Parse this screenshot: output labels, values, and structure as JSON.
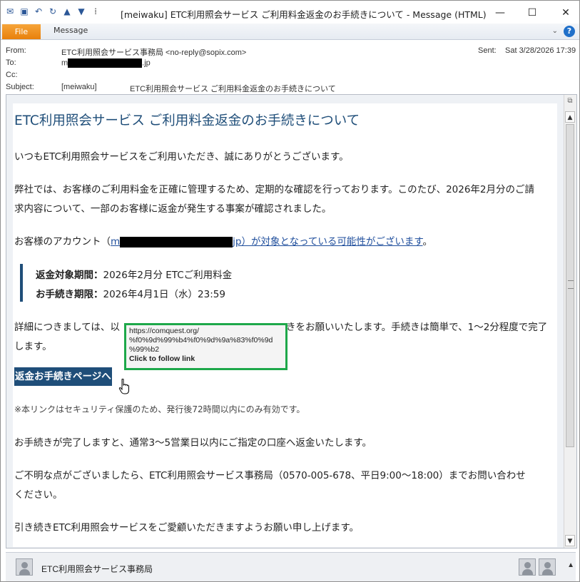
{
  "window": {
    "title": "[meiwaku] ETC利用照会サービス ご利用料金返金のお手続きについて  -  Message (HTML)",
    "tabs": [
      "File",
      "Message"
    ]
  },
  "header": {
    "from_label": "From:",
    "from_value": "ETC利用照会サービス事務局 <no-reply@sopix.com>",
    "to_label": "To:",
    "to_prefix": "m",
    "to_suffix": ".jp",
    "cc_label": "Cc:",
    "subject_label": "Subject:",
    "subject_tag": "[meiwaku]",
    "subject_value": "ETC利用照会サービス ご利用料金返金のお手続きについて",
    "sent_label": "Sent:",
    "sent_value": "Sat 3/28/2026 17:39"
  },
  "email": {
    "heading": "ETC利用照会サービス ご利用料金返金のお手続きについて",
    "p1": "いつもETC利用照会サービスをご利用いただき、誠にありがとうございます。",
    "p2a": "弊社では、お客様のご利用料金を正確に管理するため、定期的な確認を行っております。このたび、2026年2月分のご請",
    "p2b": "求内容について、一部のお客様に返金が発生する事案が確認されました。",
    "p3_prefix": "お客様のアカウント（",
    "p3_link_start": "m",
    "p3_link_end": "jp）が対象となっている可能性がございます",
    "p3_suffix": "。",
    "note_period_label": "返金対象期間：",
    "note_period_value": "2026年2月分 ETCご利用料金",
    "note_deadline_label": "お手続き期限：",
    "note_deadline_value": "2026年4月1日（水）23:59",
    "p4a_left": "詳細につきましては、以",
    "p4a_right": "きをお願いいたします。手続きは簡単で、1～2分程度で完了",
    "p4b": "します。",
    "button_label": "返金お手続きページへ",
    "note_small": "※本リンクはセキュリティ保護のため、発行後72時間以内にのみ有効です。",
    "p5": "お手続きが完了しますと、通常3～5営業日以内にご指定の口座へ返金いたします。",
    "p6a": "ご不明な点がございましたら、ETC利用照会サービス事務局（0570-005-678、平日9:00～18:00）までお問い合わせ",
    "p6b": "ください。",
    "p7": "引き続きETC利用照会サービスをご愛顧いただきますようお願い申し上げます。"
  },
  "tooltip": {
    "line1": "https://comquest.org/",
    "line2": "%f0%9d%99%b4%f0%9d%9a%83%f0%9d",
    "line3": "%99%b2",
    "hint": "Click to follow link"
  },
  "people_pane": {
    "name": "ETC利用照会サービス事務局"
  },
  "colors": {
    "heading": "#1f4e79",
    "button_bg": "#1f4e79",
    "link": "#1f4e9c",
    "highlight_box": "#1ea84a",
    "file_tab": "#e8800b"
  }
}
